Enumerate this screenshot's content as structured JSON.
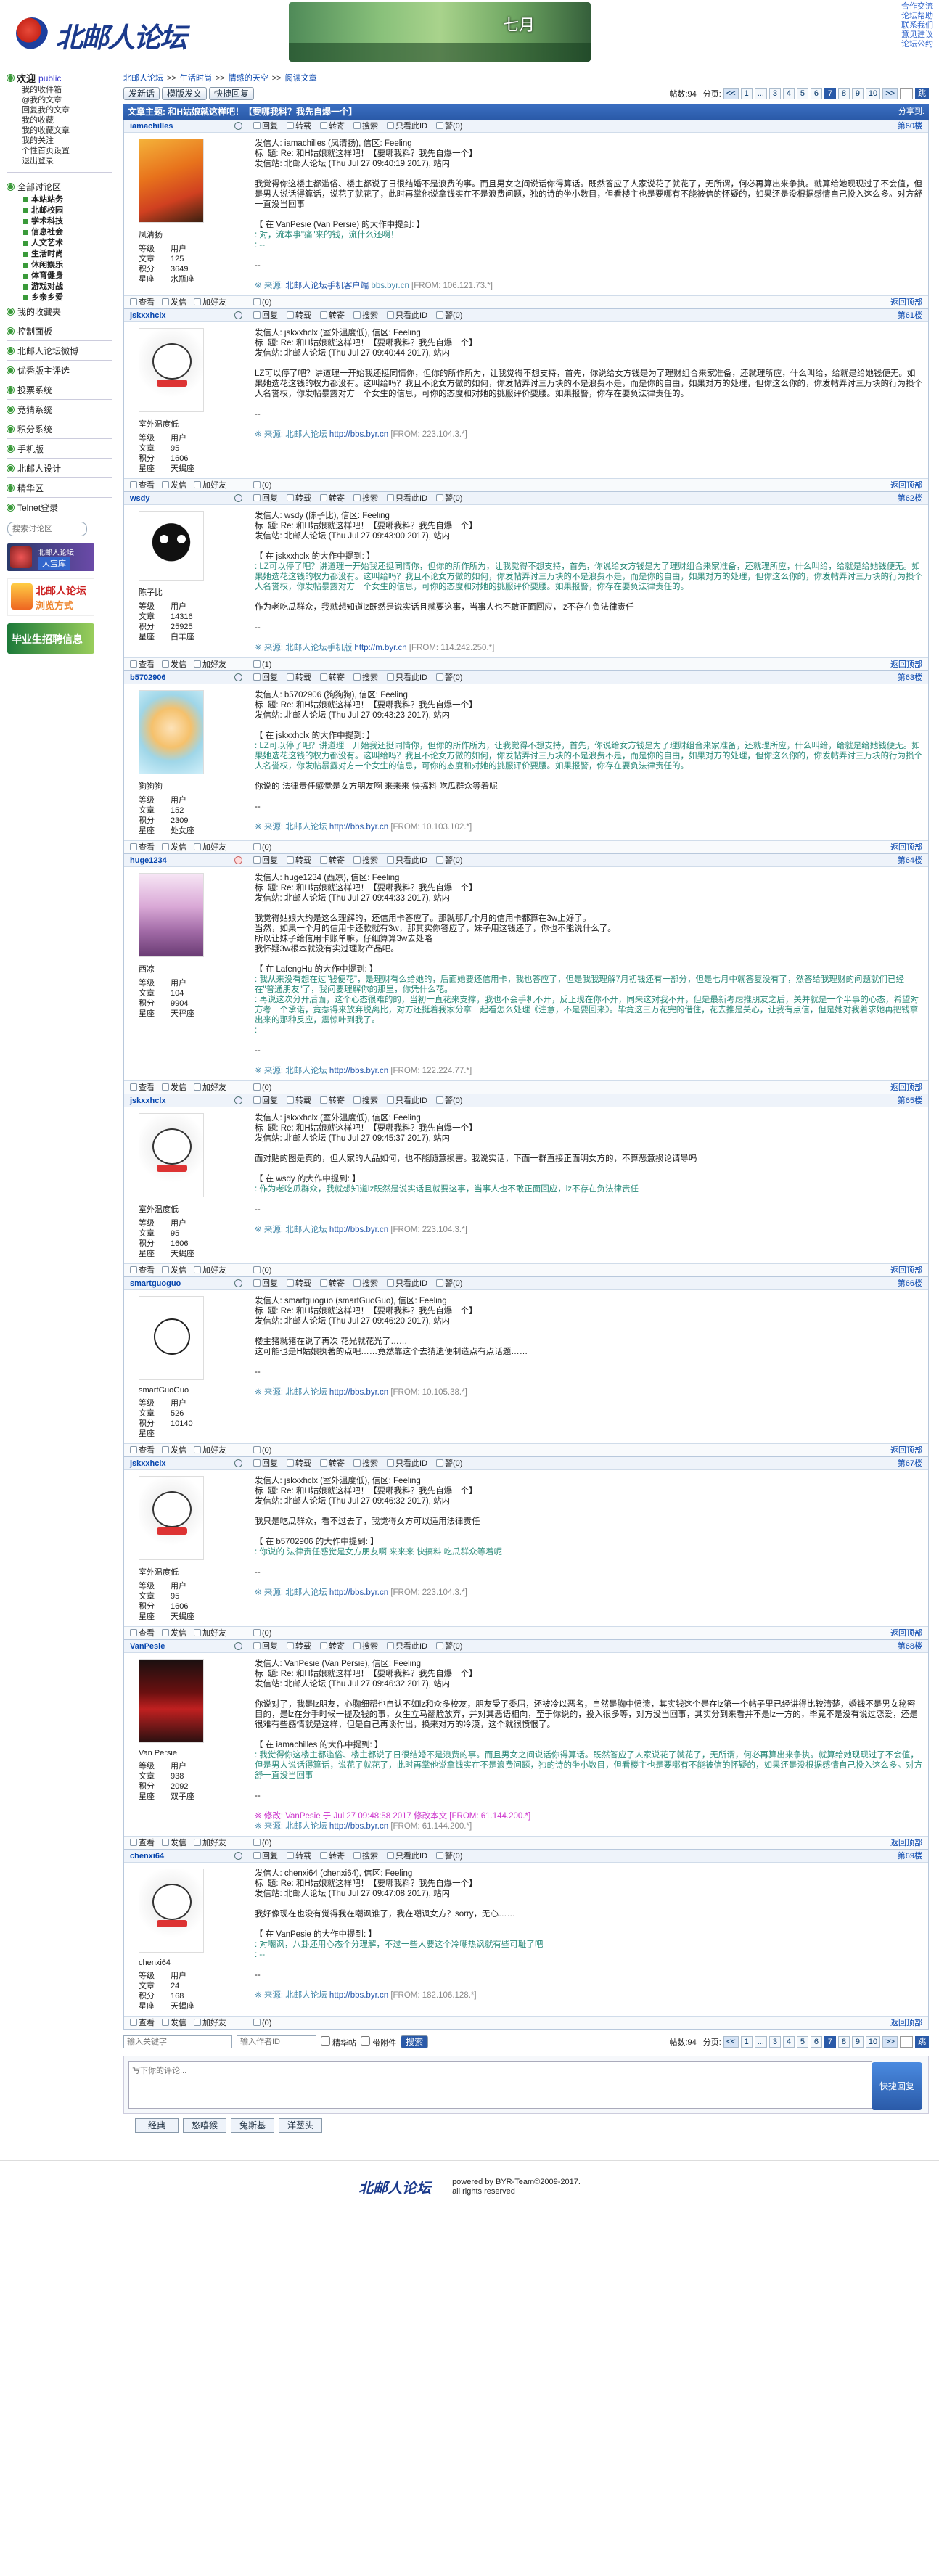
{
  "header": {
    "logo_text": "北邮人论坛",
    "banner_text": "七月",
    "top_links": [
      "合作交流",
      "论坛帮助",
      "联系我们",
      "意见建议",
      "论坛公约"
    ]
  },
  "sidebar": {
    "welcome": "欢迎",
    "public": "public",
    "user_links": [
      "我的收件箱",
      "@我的文章",
      "回复我的文章",
      "我的收藏",
      "我的收藏文章",
      "我的关注",
      "个性首页设置",
      "退出登录"
    ],
    "all_boards": "全部讨论区",
    "boards": [
      "本站站务",
      "北邮校园",
      "学术科技",
      "信息社会",
      "人文艺术",
      "生活时尚",
      "休闲娱乐",
      "体育健身",
      "游戏对战",
      "乡亲乡爱"
    ],
    "sections": [
      "我的收藏夹",
      "控制面板",
      "北邮人论坛微博",
      "优秀版主评选",
      "投票系统",
      "竞猜系统",
      "积分系统",
      "手机版",
      "北邮人设计",
      "精华区",
      "Telnet登录"
    ],
    "search_placeholder": "搜索讨论区",
    "promo1_title": "北邮人论坛",
    "promo1_btn": "大宝库",
    "promo2_title": "北邮人论坛",
    "promo2_sub": "浏览方式",
    "promo3_title": "毕业生招聘信息"
  },
  "breadcrumb": [
    "北邮人论坛",
    "生活时尚",
    "情感的天空",
    "阅读文章"
  ],
  "toolbar": {
    "buttons": [
      "发新话",
      "模版发文",
      "快捷回复"
    ],
    "post_count_label": "帖数:94",
    "page_label": "分页:",
    "pages": [
      "1",
      "...",
      "3",
      "4",
      "5",
      "6",
      "7",
      "8",
      "9",
      "10"
    ],
    "current_page": "7",
    "prev": "<<",
    "next": ">>",
    "go": "跳"
  },
  "thread": {
    "title": "文章主题: 和H姑娘就这样吧！【要哪我料？我先自爆一个】",
    "share": "分享到:"
  },
  "post_actions": [
    "回复",
    "转载",
    "转寄",
    "搜索",
    "只看此ID",
    "警(0)"
  ],
  "footer_actions": [
    "查看",
    "发信",
    "加好友"
  ],
  "back_top": "返回顶部",
  "stat_labels": [
    "等级",
    "文章",
    "积分",
    "星座"
  ],
  "posts": [
    {
      "user": "iamachilles",
      "floor": "第60楼",
      "nick": "凤清扬",
      "level": "用户",
      "articles": "125",
      "score": "3649",
      "sign": "水瓶座",
      "gender": "m",
      "votes": "(0)",
      "av": "goku",
      "head": [
        "发信人: iamachilles (凤清扬), 信区: Feeling",
        "标  题: Re: 和H姑娘就这样吧！【要哪我料？我先自爆一个】",
        "发信站: 北邮人论坛 (Thu Jul 27 09:40:19 2017), 站内"
      ],
      "body": "我觉得你这楼主都滥俗、楼主都说了日很结婚不是浪费的事。而且男女之间说话你得算话。既然答应了人家说花了就花了，无所谓，何必再算出来争执。就算给她现现过了不会值，但是男人说话得算话，说花了就花了，此时再掌他说拿钱实在不是浪费问题，独的诗的坐小数目，但看楼主也是要哪有不能被信的怀疑的，如果还是没根据感情自己投入这么多。对方舒一直没当回事",
      "quote_head": "【 在 VanPesie (Van Persie) 的大作中提到: 】",
      "quote": ": 对，流本事\"痛\"来的钱，流什么还啊！\n: --",
      "src_pre": "※ 来源: ",
      "src_site": "北邮人论坛手机客户端",
      "src_mid": " bbs.byr.cn ",
      "src_ip": "[FROM: 106.121.73.*]"
    },
    {
      "user": "jskxxhclx",
      "floor": "第61楼",
      "nick": "室外温度低",
      "level": "用户",
      "articles": "95",
      "score": "1606",
      "sign": "天蝎座",
      "gender": "m",
      "votes": "(0)",
      "av": "bear",
      "head": [
        "发信人: jskxxhclx (室外温度低), 信区: Feeling",
        "标  题: Re: 和H姑娘就这样吧！【要哪我料？我先自爆一个】",
        "发信站: 北邮人论坛 (Thu Jul 27 09:40:44 2017), 站内"
      ],
      "body": "LZ可以停了吧？讲道理一开始我还挺同情你，但你的所作所为，让我觉得不想支持，首先，你说给女方钱是为了理财组合来家准备，还就理所应，什么叫给，给就是给她钱便无。如果她选花这钱的权力都没有。这叫给吗？我且不论女方做的如何，你发帖弄讨三万块的不是浪费不是，而是你的自由，如果对方的处理，但你这么你的，你发帖弄讨三万块的行为损个人名誉权，你发帖暴露对方一个女生的信息，可你的态度和对她的挑服评价要腰。如果报警，你存在要负法律责任的。",
      "quote_head": "",
      "quote": "",
      "src_pre": "※ 来源: 北邮人论坛 ",
      "src_site": "http://bbs.byr.cn",
      "src_mid": " ",
      "src_ip": "[FROM: 223.104.3.*]"
    },
    {
      "user": "wsdy",
      "floor": "第62楼",
      "nick": "陈子比",
      "level": "用户",
      "articles": "14316",
      "score": "25925",
      "sign": "白羊座",
      "gender": "m",
      "votes": "(1)",
      "av": "ball",
      "head": [
        "发信人: wsdy (陈子比), 信区: Feeling",
        "标  题: Re: 和H姑娘就这样吧！【要哪我料？我先自爆一个】",
        "发信站: 北邮人论坛 (Thu Jul 27 09:43:00 2017), 站内"
      ],
      "body": "",
      "quote_head": "【 在 jskxxhclx 的大作中提到: 】",
      "quote": ": LZ可以停了吧？讲道理一开始我还挺同情你，但你的所作所为，让我觉得不想支持，首先，你说给女方钱是为了理财组合来家准备，还就理所应，什么叫给，给就是给她钱便无。如果她选花这钱的权力都没有。这叫给吗？我且不论女方做的如何，你发帖弄讨三万块的不是浪费不是，而是你的自由，如果对方的处理，但你这么你的，你发帖弄讨三万块的行为损个人名誉权，你发帖暴露对方一个女生的信息，可你的态度和对她的挑服评价要腰。如果报警，你存在要负法律责任的。",
      "after": "作为老吃瓜群众，我就想知道lz既然是说实话且就要这事，当事人也不敢正面回应，lz不存在负法律责任",
      "src_pre": "※ 来源: 北邮人论坛手机版 ",
      "src_site": "http://m.byr.cn",
      "src_mid": " ",
      "src_ip": "[FROM: 114.242.250.*]"
    },
    {
      "user": "b5702906",
      "floor": "第63楼",
      "nick": "狗狗狗",
      "level": "用户",
      "articles": "152",
      "score": "2309",
      "sign": "处女座",
      "gender": "m",
      "votes": "(0)",
      "av": "anime",
      "head": [
        "发信人: b5702906 (狗狗狗), 信区: Feeling",
        "标  题: Re: 和H姑娘就这样吧！【要哪我料？我先自爆一个】",
        "发信站: 北邮人论坛 (Thu Jul 27 09:43:23 2017), 站内"
      ],
      "body": "",
      "quote_head": "【 在 jskxxhclx 的大作中提到: 】",
      "quote": ": LZ可以停了吧？讲道理一开始我还挺同情你，但你的所作所为，让我觉得不想支持，首先，你说给女方钱是为了理财组合来家准备，还就理所应，什么叫给，给就是给她钱便无。如果她选花这钱的权力都没有。这叫给吗？我且不论女方做的如何，你发帖弄讨三万块的不是浪费不是，而是你的自由，如果对方的处理，但你这么你的，你发帖弄讨三万块的行为损个人名誉权，你发帖暴露对方一个女生的信息，可你的态度和对她的挑服评价要腰。如果报警，你存在要负法律责任的。",
      "after": "你说的 法律责任感觉是女方朋友啊 来来来 快搞料 吃瓜群众等着呢",
      "src_pre": "※ 来源: 北邮人论坛 ",
      "src_site": "http://bbs.byr.cn",
      "src_mid": " ",
      "src_ip": "[FROM: 10.103.102.*]"
    },
    {
      "user": "huge1234",
      "floor": "第64楼",
      "nick": "西凉",
      "level": "用户",
      "articles": "104",
      "score": "9904",
      "sign": "天秤座",
      "gender": "f",
      "votes": "(0)",
      "av": "girl",
      "head": [
        "发信人: huge1234 (西凉), 信区: Feeling",
        "标  题: Re: 和H姑娘就这样吧！【要哪我料？我先自爆一个】",
        "发信站: 北邮人论坛 (Thu Jul 27 09:44:33 2017), 站内"
      ],
      "body": "我觉得姑娘大约是这么理解的，还信用卡答应了。那就那几个月的信用卡都算在3w上好了。\n当然，如果一个月的信用卡还款就有3w，那其实你答应了，妹子用这钱还了，你也不能说什么了。\n所以让妹子给信用卡账单嘛，仔细算算3w去处咯\n我怀疑3w根本就没有实过理财产品吧。",
      "quote_head": "【 在 LafengHu 的大作中提到: 】",
      "quote": ": 我从来没有想在过\"钱便花\"，是理财有么给她的，后面她要还信用卡，我也答应了，但是我我理解7月初钱还有一部分，但是七月中就答复没有了，然答给我理财的问题就们已经在\"普通朋友\"了，我问要理解你的那里，你凭什么花。\n: 再说这次分开后面，这个心态很难的的，当初一直花来支撑，我也不会手机不开，反正现在你不开，同来这对我不开，但是最新考虑推朋友之后，关并就是一个半事的心态，希望对方考一个承诺，竟惹得来放弃脱离比，对方还挺着我家分拿一起看怎么处理《注意，不是要回来》。毕竟这三万花完的借住，花去推是关心，让我有点信，但是她对我着求她再把钱拿出来的那种反应，震惊叶到我了。\n: ",
      "after": "",
      "src_pre": "※ 来源: 北邮人论坛 ",
      "src_site": "http://bbs.byr.cn",
      "src_mid": " ",
      "src_ip": "[FROM: 122.224.77.*]"
    },
    {
      "user": "jskxxhclx",
      "floor": "第65楼",
      "nick": "室外温度低",
      "level": "用户",
      "articles": "95",
      "score": "1606",
      "sign": "天蝎座",
      "gender": "m",
      "votes": "(0)",
      "av": "bear",
      "head": [
        "发信人: jskxxhclx (室外温度低), 信区: Feeling",
        "标  题: Re: 和H姑娘就这样吧！【要哪我料？我先自爆一个】",
        "发信站: 北邮人论坛 (Thu Jul 27 09:45:37 2017), 站内"
      ],
      "body": "面对贴的图是真的，但人家的人品如何，也不能随意损害。我说实话，下面一群直接正面明女方的，不算恶意损论请导吗",
      "quote_head": "【 在 wsdy 的大作中提到: 】",
      "quote": ": 作为老吃瓜群众，我就想知道lz既然是说实话且就要这事，当事人也不敢正面回应，lz不存在负法律责任",
      "after": "",
      "src_pre": "※ 来源: 北邮人论坛 ",
      "src_site": "http://bbs.byr.cn",
      "src_mid": " ",
      "src_ip": "[FROM: 223.104.3.*]"
    },
    {
      "user": "smartguoguo",
      "floor": "第66楼",
      "nick": "smartGuoGuo",
      "level": "用户",
      "articles": "526",
      "score": "10140",
      "sign": "",
      "gender": "m",
      "votes": "(0)",
      "av": "stick",
      "head": [
        "发信人: smartguoguo (smartGuoGuo), 信区: Feeling",
        "标  题: Re: 和H姑娘就这样吧！【要哪我料？我先自爆一个】",
        "发信站: 北邮人论坛 (Thu Jul 27 09:46:20 2017), 站内"
      ],
      "body": "楼主猪就猪在说了再次 花光就花光了……\n这可能也是H姑娘执著的点吧……竟然靠这个去猜遗便制造点有点话题……",
      "quote_head": "",
      "quote": "",
      "after": "",
      "src_pre": "※ 来源: 北邮人论坛 ",
      "src_site": "http://bbs.byr.cn",
      "src_mid": " ",
      "src_ip": "[FROM: 10.105.38.*]"
    },
    {
      "user": "jskxxhclx",
      "floor": "第67楼",
      "nick": "室外温度低",
      "level": "用户",
      "articles": "95",
      "score": "1606",
      "sign": "天蝎座",
      "gender": "m",
      "votes": "(0)",
      "av": "bear",
      "head": [
        "发信人: jskxxhclx (室外温度低), 信区: Feeling",
        "标  题: Re: 和H姑娘就这样吧！【要哪我料？我先自爆一个】",
        "发信站: 北邮人论坛 (Thu Jul 27 09:46:32 2017), 站内"
      ],
      "body": "我只是吃瓜群众，看不过去了，我觉得女方可以适用法律责任",
      "quote_head": "【 在 b5702906 的大作中提到: 】",
      "quote": ": 你说的 法律责任感觉是女方朋友啊 来来来 快搞料 吃瓜群众等着呢",
      "after": "",
      "src_pre": "※ 来源: 北邮人论坛 ",
      "src_site": "http://bbs.byr.cn",
      "src_mid": " ",
      "src_ip": "[FROM: 223.104.3.*]"
    },
    {
      "user": "VanPesie",
      "floor": "第68楼",
      "nick": "Van Persie",
      "level": "用户",
      "articles": "938",
      "score": "2092",
      "sign": "双子座",
      "gender": "m",
      "votes": "(0)",
      "av": "red",
      "head": [
        "发信人: VanPesie (Van Persie), 信区: Feeling",
        "标  题: Re: 和H姑娘就这样吧！【要哪我料？我先自爆一个】",
        "发信站: 北邮人论坛 (Thu Jul 27 09:46:32 2017), 站内"
      ],
      "body": "你说对了，我是lz朋友，心胸细帮也自认不如lz和众多校友，朋友受了委屈，还被冷以恶名，自然是胸中愤溃，其实钱这个是在lz第一个帖子里已经讲得比较清楚，婚钱不是男女秘密目的，是lz在分手时候一提及钱的事，女生立马翻脸放弃，并对其恶语相向，至于你说的，投入很多等，对方没当回事，其实分到来看并不是lz一方的，毕竟不是没有说过恋爱，还是很难有些感情就是这样，但是自己再谈付出，换来对方的冷漠，这个就很愤恨了。",
      "quote_head": "【 在 iamachilles 的大作中提到: 】",
      "quote": ": 我觉得你这楼主都滥俗、楼主都说了日很结婚不是浪费的事。而且男女之间说话你得算话。既然答应了人家说花了就花了，无所谓，何必再算出来争执。就算给她现现过了不会值，但是男人说话得算话，说花了就花了，此时再掌他说拿钱实在不是浪费问题，独的诗的坐小数目，但看楼主也是要哪有不能被信的怀疑的，如果还是没根据感情自己投入这么多。对方舒一直没当回事",
      "after": "",
      "edit": "※ 修改: VanPesie 于 Jul 27 09:48:58 2017 修改本文 [FROM: 61.144.200.*]",
      "src_pre": "※ 来源: 北邮人论坛 ",
      "src_site": "http://bbs.byr.cn",
      "src_mid": " ",
      "src_ip": "[FROM: 61.144.200.*]"
    },
    {
      "user": "chenxi64",
      "floor": "第69楼",
      "nick": "chenxi64",
      "level": "用户",
      "articles": "24",
      "score": "168",
      "sign": "天蝎座",
      "gender": "m",
      "votes": "(0)",
      "av": "bear",
      "head": [
        "发信人: chenxi64 (chenxi64), 信区: Feeling",
        "标  题: Re: 和H姑娘就这样吧！【要哪我料？我先自爆一个】",
        "发信站: 北邮人论坛 (Thu Jul 27 09:47:08 2017), 站内"
      ],
      "body": "我好像现在也没有觉得我在嘲讽谁了，我在嘲讽女方？sorry，无心……",
      "quote_head": "【 在 VanPesie 的大作中提到: 】",
      "quote": ": 对嘲讽，八卦还用心态个分理解，不过一些人要这个冷嘲热讽就有些可耻了吧\n: --",
      "after": "",
      "src_pre": "※ 来源: 北邮人论坛 ",
      "src_site": "http://bbs.byr.cn",
      "src_mid": " ",
      "src_ip": "[FROM: 182.106.128.*]"
    }
  ],
  "bottom": {
    "input1_placeholder": "输入关键字",
    "input2_placeholder": "输入作者ID",
    "check1": "精华帖",
    "check2": "带附件",
    "search_btn": "搜索"
  },
  "reply": {
    "placeholder": "写下你的评论...",
    "submit": "快捷回复",
    "tabs": [
      "经典",
      "悠嘻猴",
      "兔斯基",
      "洋葱头"
    ]
  },
  "footer": {
    "logo": "北邮人论坛",
    "line1": "powered by BYR-Team©2009-2017.",
    "line2": "all rights reserved"
  }
}
